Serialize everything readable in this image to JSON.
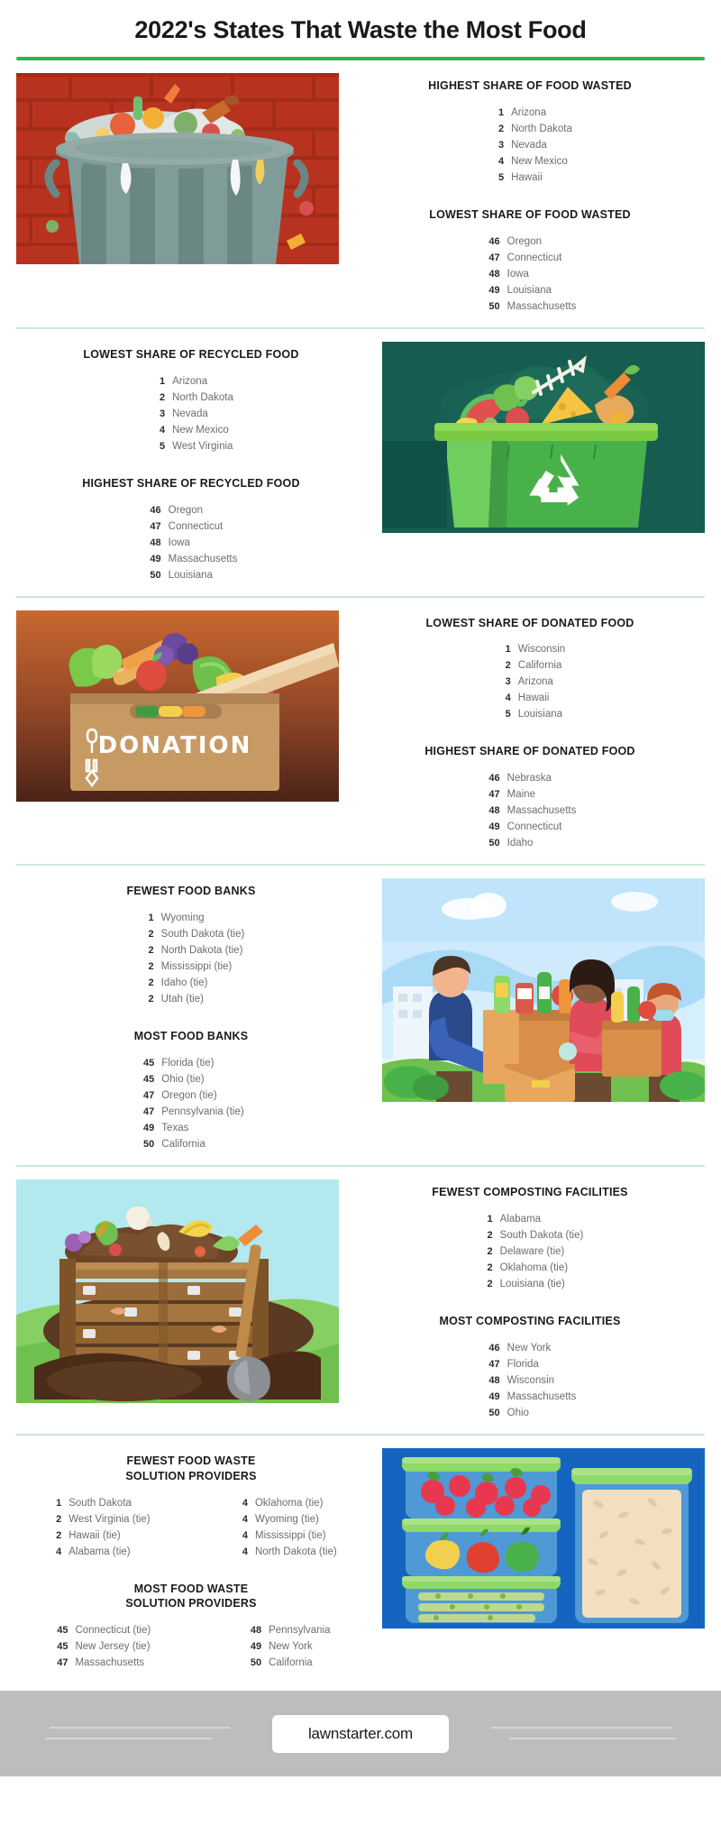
{
  "header": {
    "title": "2022's States That Waste the Most Food",
    "accent_color": "#2eb458"
  },
  "sections": [
    {
      "id": "food-wasted",
      "art": "trash-can-overflowing",
      "art_side": "left",
      "blocks": [
        {
          "title": "HIGHEST SHARE OF FOOD WASTED",
          "items": [
            {
              "rank": "1",
              "name": "Arizona"
            },
            {
              "rank": "2",
              "name": "North Dakota"
            },
            {
              "rank": "3",
              "name": "Nevada"
            },
            {
              "rank": "4",
              "name": "New Mexico"
            },
            {
              "rank": "5",
              "name": "Hawaii"
            }
          ]
        },
        {
          "title": "LOWEST SHARE OF FOOD WASTED",
          "items": [
            {
              "rank": "46",
              "name": "Oregon"
            },
            {
              "rank": "47",
              "name": "Connecticut"
            },
            {
              "rank": "48",
              "name": "Iowa"
            },
            {
              "rank": "49",
              "name": "Louisiana"
            },
            {
              "rank": "50",
              "name": "Massachusetts"
            }
          ]
        }
      ]
    },
    {
      "id": "recycled-food",
      "art": "green-recycling-bin",
      "art_side": "right",
      "blocks": [
        {
          "title": "LOWEST SHARE OF RECYCLED FOOD",
          "items": [
            {
              "rank": "1",
              "name": "Arizona"
            },
            {
              "rank": "2",
              "name": "North Dakota"
            },
            {
              "rank": "3",
              "name": "Nevada"
            },
            {
              "rank": "4",
              "name": "New Mexico"
            },
            {
              "rank": "5",
              "name": "West Virginia"
            }
          ]
        },
        {
          "title": "HIGHEST SHARE OF RECYCLED FOOD",
          "items": [
            {
              "rank": "46",
              "name": "Oregon"
            },
            {
              "rank": "47",
              "name": "Connecticut"
            },
            {
              "rank": "48",
              "name": "Iowa"
            },
            {
              "rank": "49",
              "name": "Massachusetts"
            },
            {
              "rank": "50",
              "name": "Louisiana"
            }
          ]
        }
      ]
    },
    {
      "id": "donated-food",
      "art": "donation-box",
      "art_side": "left",
      "blocks": [
        {
          "title": "LOWEST SHARE OF DONATED FOOD",
          "items": [
            {
              "rank": "1",
              "name": "Wisconsin"
            },
            {
              "rank": "2",
              "name": "California"
            },
            {
              "rank": "3",
              "name": "Arizona"
            },
            {
              "rank": "4",
              "name": "Hawaii"
            },
            {
              "rank": "5",
              "name": "Louisiana"
            }
          ]
        },
        {
          "title": "HIGHEST SHARE OF DONATED FOOD",
          "items": [
            {
              "rank": "46",
              "name": "Nebraska"
            },
            {
              "rank": "47",
              "name": "Maine"
            },
            {
              "rank": "48",
              "name": "Massachusetts"
            },
            {
              "rank": "49",
              "name": "Connecticut"
            },
            {
              "rank": "50",
              "name": "Idaho"
            }
          ]
        }
      ]
    },
    {
      "id": "food-banks",
      "art": "volunteers-with-boxes",
      "art_side": "right",
      "blocks": [
        {
          "title": "FEWEST FOOD BANKS",
          "items": [
            {
              "rank": "1",
              "name": "Wyoming"
            },
            {
              "rank": "2",
              "name": "South Dakota (tie)"
            },
            {
              "rank": "2",
              "name": "North Dakota (tie)"
            },
            {
              "rank": "2",
              "name": "Mississippi (tie)"
            },
            {
              "rank": "2",
              "name": "Idaho (tie)"
            },
            {
              "rank": "2",
              "name": "Utah (tie)"
            }
          ]
        },
        {
          "title": "MOST FOOD BANKS",
          "items": [
            {
              "rank": "45",
              "name": "Florida (tie)"
            },
            {
              "rank": "45",
              "name": "Ohio (tie)"
            },
            {
              "rank": "47",
              "name": "Oregon (tie)"
            },
            {
              "rank": "47",
              "name": "Pennsylvania (tie)"
            },
            {
              "rank": "49",
              "name": "Texas"
            },
            {
              "rank": "50",
              "name": "California"
            }
          ]
        }
      ]
    },
    {
      "id": "composting-facilities",
      "art": "compost-bin",
      "art_side": "left",
      "blocks": [
        {
          "title": "FEWEST COMPOSTING FACILITIES",
          "items": [
            {
              "rank": "1",
              "name": "Alabama"
            },
            {
              "rank": "2",
              "name": "South Dakota (tie)"
            },
            {
              "rank": "2",
              "name": "Delaware (tie)"
            },
            {
              "rank": "2",
              "name": "Oklahoma (tie)"
            },
            {
              "rank": "2",
              "name": "Louisiana (tie)"
            }
          ]
        },
        {
          "title": "MOST COMPOSTING FACILITIES",
          "items": [
            {
              "rank": "46",
              "name": "New York"
            },
            {
              "rank": "47",
              "name": "Florida"
            },
            {
              "rank": "48",
              "name": "Wisconsin"
            },
            {
              "rank": "49",
              "name": "Massachusetts"
            },
            {
              "rank": "50",
              "name": "Ohio"
            }
          ]
        }
      ]
    },
    {
      "id": "solution-providers",
      "art": "food-storage-containers",
      "art_side": "right",
      "blocks": [
        {
          "title": "FEWEST FOOD WASTE\nSOLUTION PROVIDERS",
          "title_line1": "FEWEST FOOD WASTE",
          "title_line2": "SOLUTION PROVIDERS",
          "col_left": [
            {
              "rank": "1",
              "name": "South Dakota"
            },
            {
              "rank": "2",
              "name": "West Virginia (tie)"
            },
            {
              "rank": "2",
              "name": "Hawaii (tie)"
            },
            {
              "rank": "4",
              "name": "Alabama (tie)"
            }
          ],
          "col_right": [
            {
              "rank": "4",
              "name": "Oklahoma (tie)"
            },
            {
              "rank": "4",
              "name": "Wyoming (tie)"
            },
            {
              "rank": "4",
              "name": "Mississippi (tie)"
            },
            {
              "rank": "4",
              "name": "North Dakota (tie)"
            }
          ]
        },
        {
          "title_line1": "MOST FOOD WASTE",
          "title_line2": "SOLUTION PROVIDERS",
          "col_left": [
            {
              "rank": "45",
              "name": "Connecticut (tie)"
            },
            {
              "rank": "45",
              "name": "New Jersey (tie)"
            },
            {
              "rank": "47",
              "name": "Massachusetts"
            }
          ],
          "col_right": [
            {
              "rank": "48",
              "name": "Pennsylvania"
            },
            {
              "rank": "49",
              "name": "New York"
            },
            {
              "rank": "50",
              "name": "California"
            }
          ]
        }
      ]
    }
  ],
  "footer": {
    "brand": "lawnstarter.com",
    "background_color": "#bdbdbd"
  }
}
